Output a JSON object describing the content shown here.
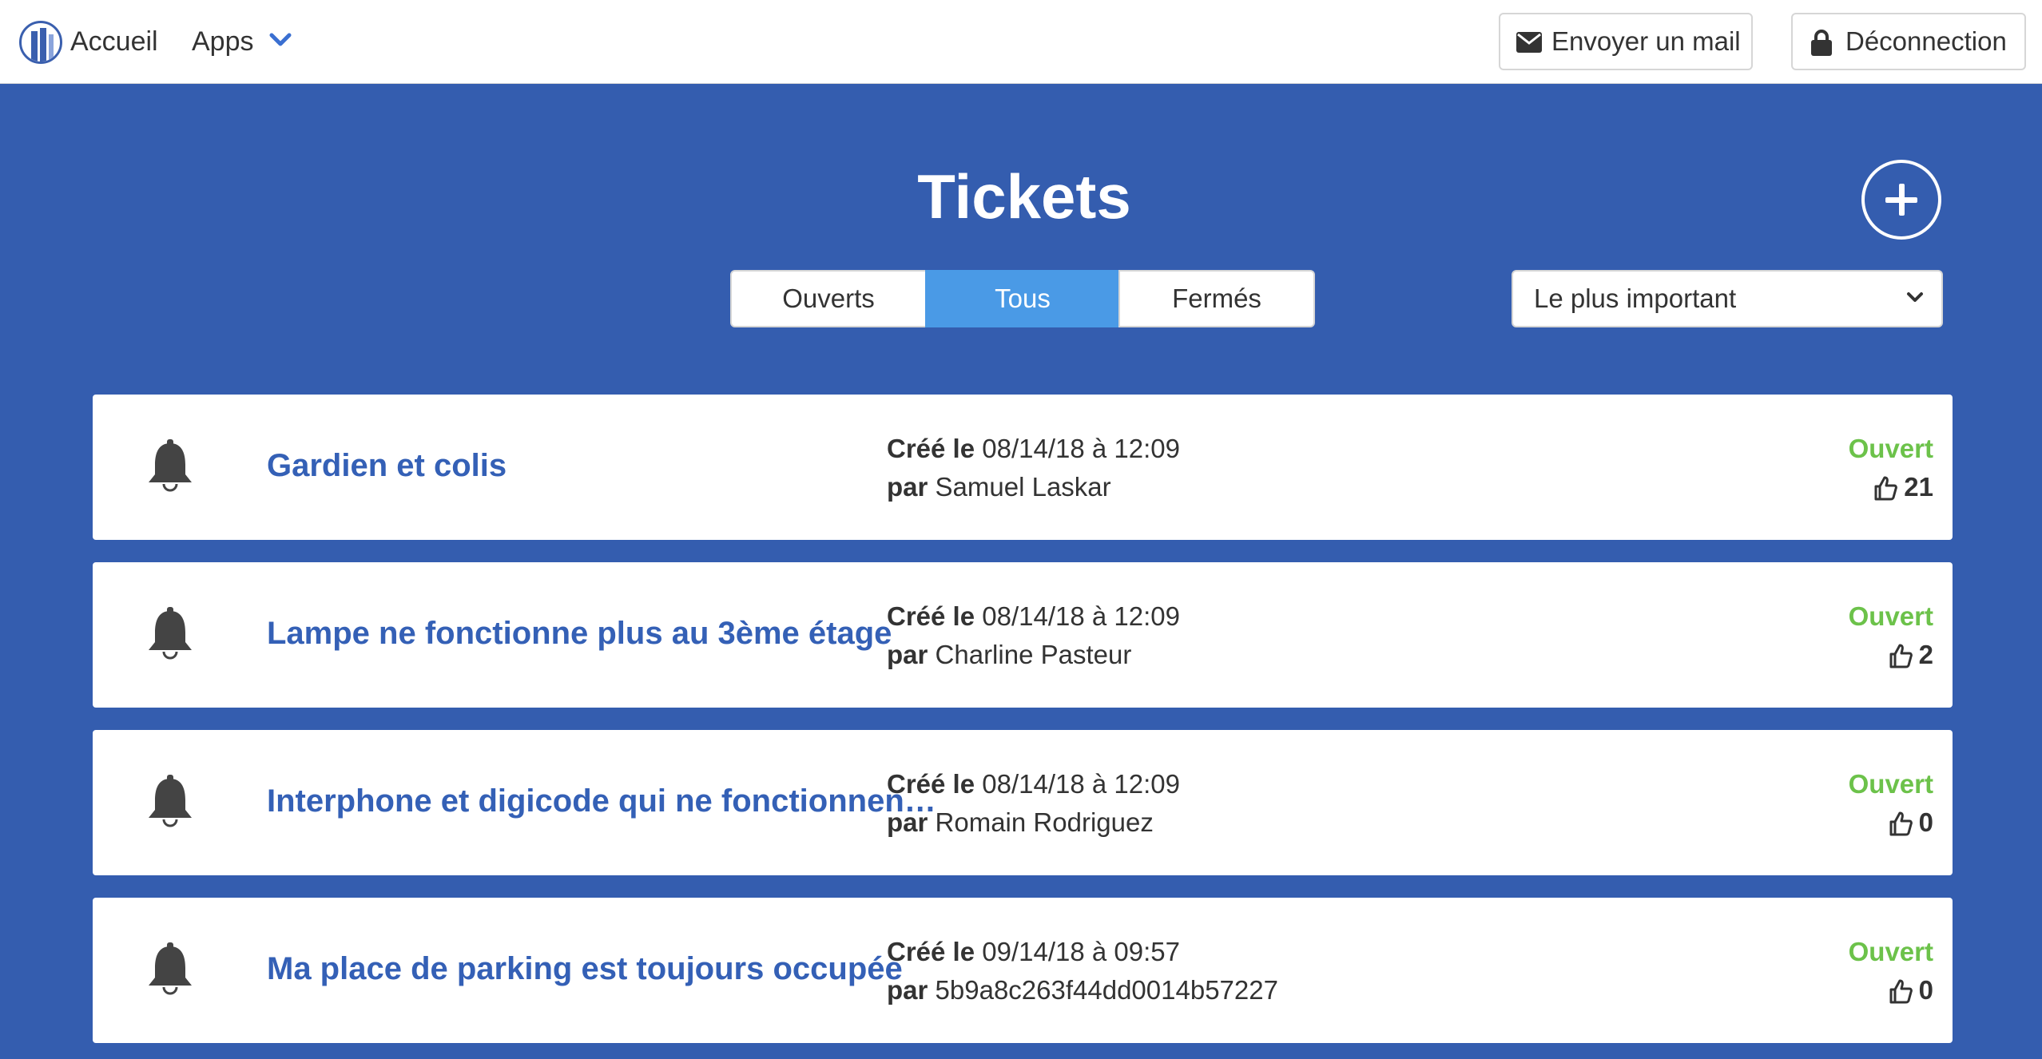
{
  "nav": {
    "home_label": "Accueil",
    "apps_label": "Apps",
    "mail_button": "Envoyer un mail",
    "logout_button": "Déconnection"
  },
  "page": {
    "title": "Tickets",
    "tabs": [
      {
        "label": "Ouverts",
        "active": false
      },
      {
        "label": "Tous",
        "active": true
      },
      {
        "label": "Fermés",
        "active": false
      }
    ],
    "sort_selected": "Le plus important"
  },
  "labels": {
    "created": "Créé le",
    "by": "par"
  },
  "colors": {
    "background": "#345daf",
    "accent": "#4a9ae6",
    "title_link": "#3460b6",
    "status_open": "#6cc24a"
  },
  "tickets": [
    {
      "title": "Gardien et colis",
      "created": "08/14/18 à 12:09",
      "author": "Samuel Laskar",
      "status": "Ouvert",
      "votes": "21"
    },
    {
      "title": "Lampe ne fonctionne plus au 3ème étage",
      "created": "08/14/18 à 12:09",
      "author": "Charline Pasteur",
      "status": "Ouvert",
      "votes": "2"
    },
    {
      "title": "Interphone et digicode qui ne fonctionnent pas",
      "created": "08/14/18 à 12:09",
      "author": "Romain Rodriguez",
      "status": "Ouvert",
      "votes": "0"
    },
    {
      "title": "Ma place de parking est toujours occupée",
      "created": "09/14/18 à 09:57",
      "author": "5b9a8c263f44dd0014b57227",
      "status": "Ouvert",
      "votes": "0"
    }
  ]
}
